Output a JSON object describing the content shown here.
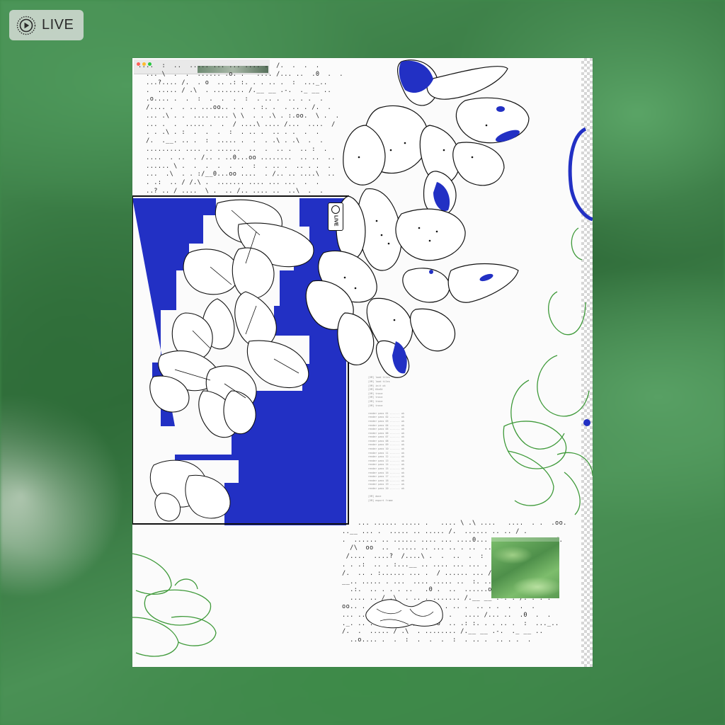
{
  "badge": {
    "label": "LIVE",
    "icon": "live-photo-icon"
  },
  "inset_badge": {
    "label": "LIVE"
  },
  "colors": {
    "cobalt": "#2230c4",
    "line_green": "#3f9a3a",
    "ink": "#111111",
    "paper": "#fbfbfb"
  },
  "ascii_blocks": {
    "top": "....  :  ..  ..... ... ... .... .  /.  .  .  .\n  ... \\  .  .  ...... .o. .   .... /... ..  .0  .  .\n  ...?.... /.  . o  .. .: :. . . .. .  :  ..._..\n  .  ..... / .\\  . ........ /.__ __ .-.  ._ __ ..\n  .o.... .  .  :  .  .  .  :  . .. .  .. . .  .\n  /.... .  . .. ...oo.. . .  . :. .  . .. . /.  .\n  ... .\\ . .  .... .... \\ \\  . . .\\ . :.oo.  \\ .  .\n  ... .  .  ..... .  .  / ....\\ .... /...  ....  /\n  . . .\\ . :  .  .  .  :  . .. .  .. . .  .  .\n  /.  .__. .. .  :  ..... .  .  . .\\ . .\\  .  .\n  ......... .... .. ......  ..  .  .. .  .. :  .\n  ....  . ..  . /.. . ..0...oo ........  .. ..  ..\n  ...... \\ .  .  .  .  .  .  :  . .. .  .. . .  .\n  ...  .\\  . . :/__0...oo ....  . /.. .. ....\\  ..\n  . .:  .. / /.\\ .  ....... .... ... ...  .  .\n  ..? .. / ....  \\ .  .. /.. .... ..  ..\\  .  .",
    "bottom": "..  ... ...... ..... .   .... \\ .\\ ....   ....  . .  .oo.\n..__ ... .  ..... .. ..... /.  ...... .. .. / .\n.  ...... .. ...... .... ... ....0... .. ........  .. /.\n  /\\  oo  ..  ..... .. ... .. . ..  .. .. \\\\   \\.\n /....  ....?  /....\\ .  .  ..  .  :  ..  .  .\n. . .:  .. . :...__ .. .... ... ... .  .  . .  . .\n/.  .. . :...... ... .  / ...... ... /  .. .:\\ ..\n__.. ..... . ...  .... ..... ..  :. ... .. . /.. ..\n  .:.  .. . . . ..   .0 .  ..  ......oo   . .. /.  .\n  .... .. / .\\  . .. . ....... /.__ __ .-. . /. . . .\noo.. .  .  :  .  .  .  :  . .. .  .. . .  .  .  .\n... ... \\ .  .  ...... .o. .   .... /... ..  .0  .  .\n._. .. . ...?.... /.  . o  .. .: :. . . .. .  :  ..._..\n/.  .  ..... / .\\  . ........ /.__ __ .-.  ._ __ ..\n  ..o.... .  .  :  .  .  .  :  . .. .  .. . .  ."
  },
  "terminal_log": "[VM] load tiles\n[VM] load tiles\n[VM] init ok\n[VM] 64x64\n[VM] trace\n[VM] trace\n[VM] trace\n[VM] trace\n\nrender pass 01 ....... ok\nrender pass 02 ....... ok\nrender pass 03 ....... ok\nrender pass 04 ....... ok\nrender pass 05 ....... ok\nrender pass 06 ....... ok\nrender pass 07 ....... ok\nrender pass 08 ....... ok\nrender pass 09 ....... ok\nrender pass 10 ....... ok\nrender pass 11 ....... ok\nrender pass 12 ....... ok\nrender pass 13 ....... ok\nrender pass 14 ....... ok\nrender pass 15 ....... ok\nrender pass 16 ....... ok\nrender pass 17 ....... ok\nrender pass 18 ....... ok\nrender pass 19 ....... ok\nrender pass 20 ....... ok\n\n[VM] done\n[VM] export frame"
}
